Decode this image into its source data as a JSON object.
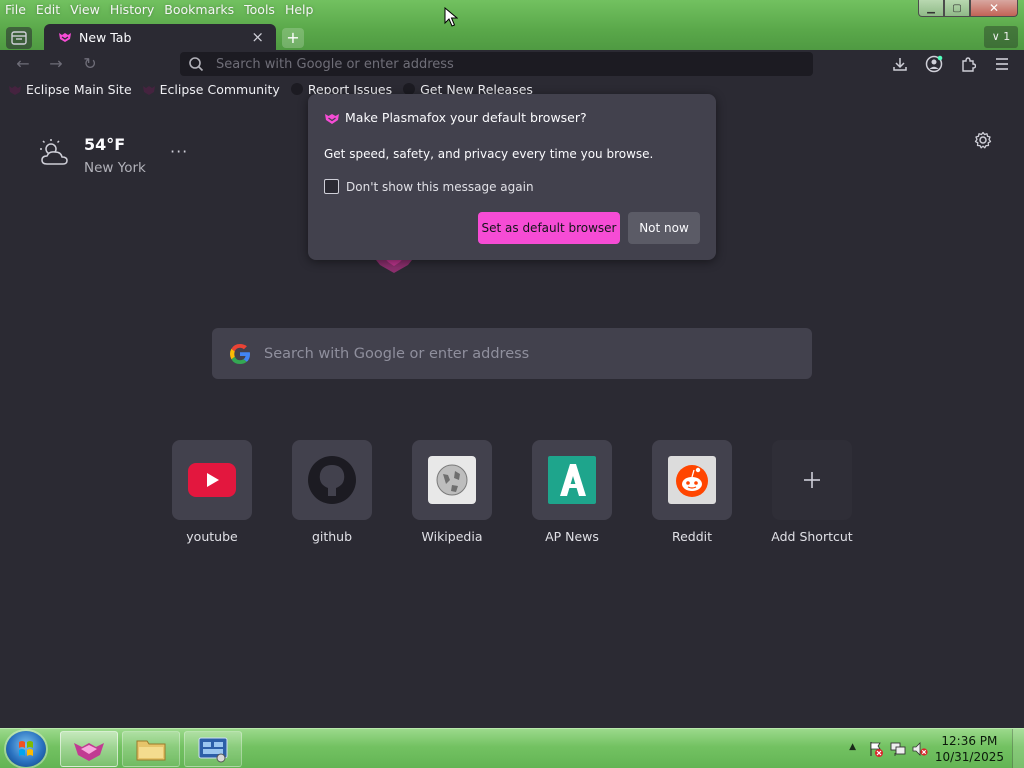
{
  "menu": [
    "File",
    "Edit",
    "View",
    "History",
    "Bookmarks",
    "Tools",
    "Help"
  ],
  "tab": {
    "title": "New Tab",
    "close": "×"
  },
  "newtab_symbol": "+",
  "tab_count": "∨ 1",
  "window_controls": {
    "min": "▁",
    "max": "▢",
    "close": "✕"
  },
  "urlbar": {
    "placeholder": "Search with Google or enter address"
  },
  "bookmarks": [
    "Eclipse Main Site",
    "Eclipse Community",
    "Report Issues",
    "Get New Releases"
  ],
  "weather": {
    "temp": "54°F",
    "city": "New York",
    "menu": "···"
  },
  "search": {
    "placeholder": "Search with Google or enter address"
  },
  "shortcuts": [
    {
      "label": "youtube",
      "icon": "youtube-icon"
    },
    {
      "label": "github",
      "icon": "github-icon"
    },
    {
      "label": "Wikipedia",
      "icon": "wikipedia-icon"
    },
    {
      "label": "AP News",
      "icon": "ap-news-icon"
    },
    {
      "label": "Reddit",
      "icon": "reddit-icon"
    },
    {
      "label": "Add Shortcut",
      "icon": "plus-icon"
    }
  ],
  "popup": {
    "title": "Make Plasmafox your default browser?",
    "description": "Get speed, safety, and privacy every time you browse.",
    "checkbox_label": "Don't show this message again",
    "primary_button": "Set as default browser",
    "secondary_button": "Not now"
  },
  "taskbar": {
    "time": "12:36 PM",
    "date": "10/31/2025"
  },
  "colors": {
    "accent": "#f64cd5",
    "content_bg": "#2b2a33",
    "card_bg": "#42414d",
    "taskbar_green": "#6dbf5b"
  }
}
